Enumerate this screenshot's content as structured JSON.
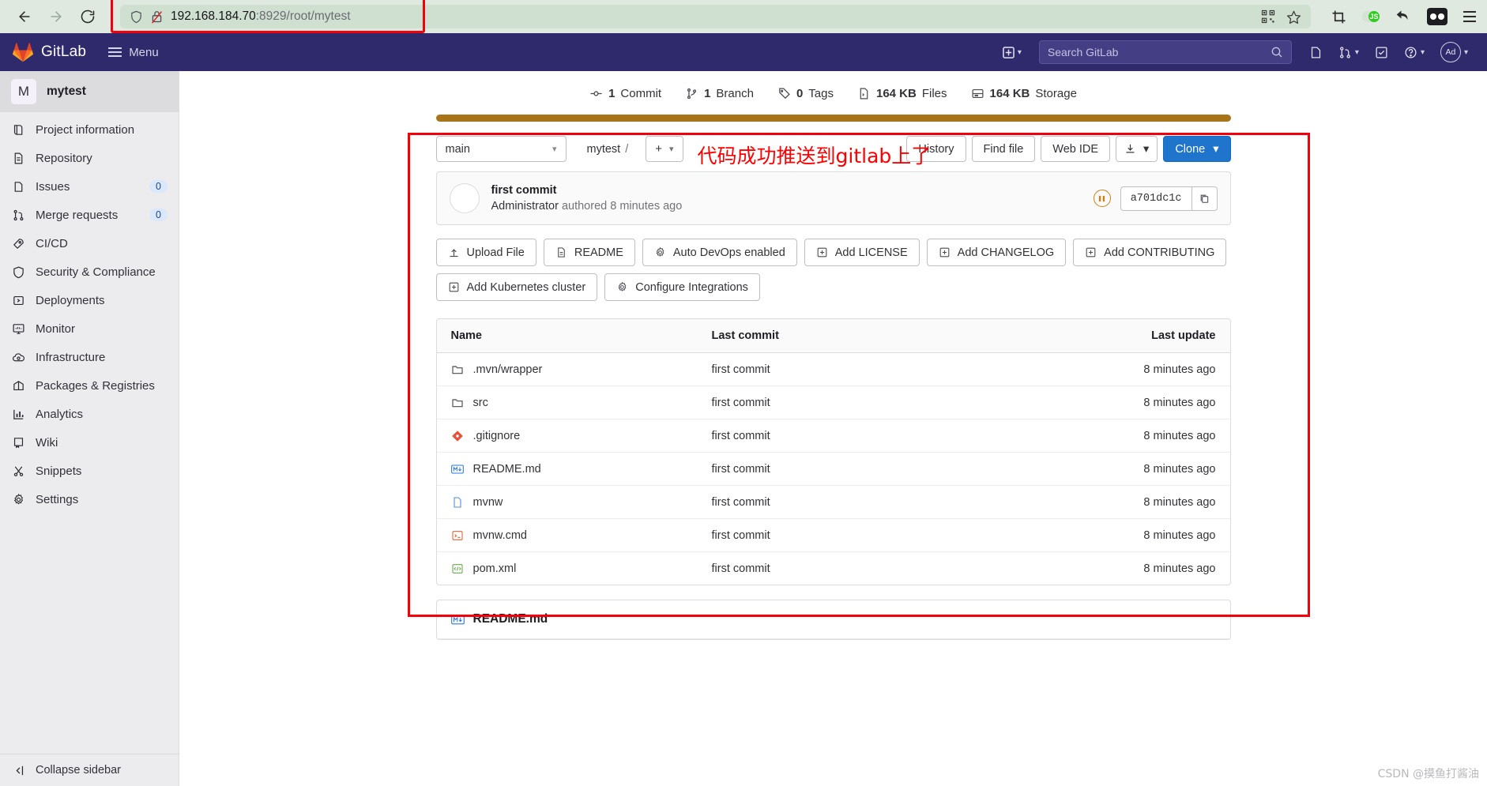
{
  "browser": {
    "back_label": "Back",
    "forward_label": "Forward",
    "reload_label": "Reload",
    "url_host": "192.168.184.70",
    "url_rest": ":8929/root/mytest",
    "qr_icon": "qr-code-icon",
    "bookmark_icon": "star-icon",
    "crop_icon": "crop-icon",
    "js_badge_label": "JS",
    "undo_icon": "undo-arrow-icon",
    "extension_icon": "extension-icon",
    "menu_icon": "browser-menu-icon"
  },
  "gitlab_header": {
    "brand": "GitLab",
    "menu_label": "Menu",
    "create_new_label": "Create new",
    "search_placeholder": "Search GitLab",
    "issues_label": "Issues",
    "merge_requests_label": "Merge requests",
    "todos_label": "To-Do list",
    "help_label": "Help",
    "avatar_initials": "Ad"
  },
  "sidebar": {
    "project_initial": "M",
    "project_name": "mytest",
    "items": [
      {
        "label": "Project information",
        "icon": "project-information-icon",
        "badge": ""
      },
      {
        "label": "Repository",
        "icon": "repository-icon",
        "badge": ""
      },
      {
        "label": "Issues",
        "icon": "issues-icon",
        "badge": "0"
      },
      {
        "label": "Merge requests",
        "icon": "merge-requests-icon",
        "badge": "0"
      },
      {
        "label": "CI/CD",
        "icon": "rocket-icon",
        "badge": ""
      },
      {
        "label": "Security & Compliance",
        "icon": "shield-icon",
        "badge": ""
      },
      {
        "label": "Deployments",
        "icon": "deployments-icon",
        "badge": ""
      },
      {
        "label": "Monitor",
        "icon": "monitor-icon",
        "badge": ""
      },
      {
        "label": "Infrastructure",
        "icon": "cloud-icon",
        "badge": ""
      },
      {
        "label": "Packages & Registries",
        "icon": "package-icon",
        "badge": ""
      },
      {
        "label": "Analytics",
        "icon": "analytics-icon",
        "badge": ""
      },
      {
        "label": "Wiki",
        "icon": "book-icon",
        "badge": ""
      },
      {
        "label": "Snippets",
        "icon": "scissors-icon",
        "badge": ""
      },
      {
        "label": "Settings",
        "icon": "gear-icon",
        "badge": ""
      }
    ],
    "collapse_label": "Collapse sidebar"
  },
  "stats": [
    {
      "value": "1",
      "label": "Commit",
      "icon": "commit-icon"
    },
    {
      "value": "1",
      "label": "Branch",
      "icon": "branch-icon"
    },
    {
      "value": "0",
      "label": "Tags",
      "icon": "tag-icon"
    },
    {
      "value": "164 KB",
      "label": "Files",
      "icon": "file-icon"
    },
    {
      "value": "164 KB",
      "label": "Storage",
      "icon": "storage-icon"
    }
  ],
  "language_bar_color": "#a8741a",
  "toolbar": {
    "branch": "main",
    "breadcrumb_project": "mytest",
    "breadcrumb_sep": "/",
    "add_label": "+",
    "history_label": "History",
    "find_file_label": "Find file",
    "web_ide_label": "Web IDE",
    "download_label": "Download",
    "clone_label": "Clone"
  },
  "commit": {
    "title": "first commit",
    "author": "Administrator",
    "meta": "authored 8 minutes ago",
    "sha": "a701dc1c",
    "pipeline_status": "pending",
    "copy_label": "Copy commit SHA"
  },
  "annotation": "代码成功推送到gitlab上了",
  "annotation_color": "#fe0000",
  "quick_actions": [
    {
      "label": "Upload File",
      "icon": "upload-icon"
    },
    {
      "label": "README",
      "icon": "readme-icon"
    },
    {
      "label": "Auto DevOps enabled",
      "icon": "gear-icon"
    },
    {
      "label": "Add LICENSE",
      "icon": "plus-box-icon"
    },
    {
      "label": "Add CHANGELOG",
      "icon": "plus-box-icon"
    },
    {
      "label": "Add CONTRIBUTING",
      "icon": "plus-box-icon"
    },
    {
      "label": "Add Kubernetes cluster",
      "icon": "plus-box-icon"
    },
    {
      "label": "Configure Integrations",
      "icon": "gear-icon"
    }
  ],
  "file_table": {
    "columns": {
      "name": "Name",
      "last_commit": "Last commit",
      "last_update": "Last update"
    },
    "rows": [
      {
        "name": ".mvn/wrapper",
        "icon": "folder-icon",
        "last_commit": "first commit",
        "last_update": "8 minutes ago"
      },
      {
        "name": "src",
        "icon": "folder-icon",
        "last_commit": "first commit",
        "last_update": "8 minutes ago"
      },
      {
        "name": ".gitignore",
        "icon": "git-icon",
        "last_commit": "first commit",
        "last_update": "8 minutes ago"
      },
      {
        "name": "README.md",
        "icon": "markdown-icon",
        "last_commit": "first commit",
        "last_update": "8 minutes ago"
      },
      {
        "name": "mvnw",
        "icon": "file-icon",
        "last_commit": "first commit",
        "last_update": "8 minutes ago"
      },
      {
        "name": "mvnw.cmd",
        "icon": "terminal-icon",
        "last_commit": "first commit",
        "last_update": "8 minutes ago"
      },
      {
        "name": "pom.xml",
        "icon": "xml-icon",
        "last_commit": "first commit",
        "last_update": "8 minutes ago"
      }
    ]
  },
  "readme": {
    "title": "README.md",
    "icon": "markdown-icon"
  },
  "watermark": "CSDN @摸鱼打酱油"
}
